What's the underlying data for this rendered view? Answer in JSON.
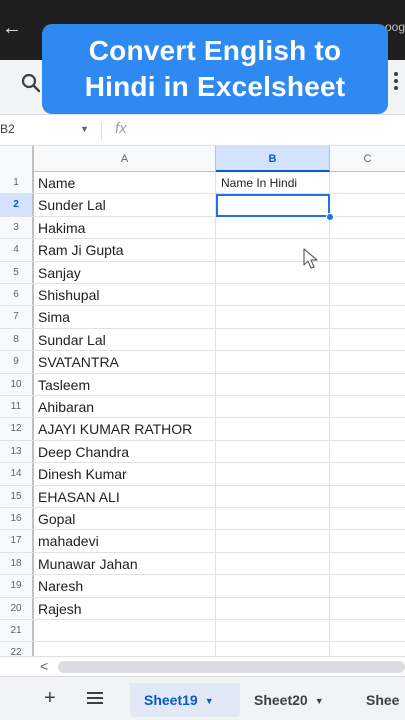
{
  "topbar": {
    "url_fragment": "oog"
  },
  "banner": {
    "line1": "Convert English to",
    "line2": "Hindi in Excelsheet"
  },
  "formula": {
    "cell_ref": "B2",
    "fx": "fx"
  },
  "columns": [
    "A",
    "B",
    "C"
  ],
  "rows": [
    {
      "num": "1",
      "a": "Name",
      "b": "Name In Hindi"
    },
    {
      "num": "2",
      "a": "Sunder Lal",
      "b": ""
    },
    {
      "num": "3",
      "a": "Hakima",
      "b": ""
    },
    {
      "num": "4",
      "a": "Ram Ji Gupta",
      "b": ""
    },
    {
      "num": "5",
      "a": "Sanjay",
      "b": ""
    },
    {
      "num": "6",
      "a": "Shishupal",
      "b": ""
    },
    {
      "num": "7",
      "a": "Sima",
      "b": ""
    },
    {
      "num": "8",
      "a": "Sundar Lal",
      "b": ""
    },
    {
      "num": "9",
      "a": "SVATANTRA",
      "b": ""
    },
    {
      "num": "10",
      "a": "Tasleem",
      "b": ""
    },
    {
      "num": "11",
      "a": "Ahibaran",
      "b": ""
    },
    {
      "num": "12",
      "a": "AJAYI KUMAR RATHOR",
      "b": ""
    },
    {
      "num": "13",
      "a": "Deep Chandra",
      "b": ""
    },
    {
      "num": "14",
      "a": "Dinesh Kumar",
      "b": ""
    },
    {
      "num": "15",
      "a": "EHASAN ALI",
      "b": ""
    },
    {
      "num": "16",
      "a": "Gopal",
      "b": ""
    },
    {
      "num": "17",
      "a": "mahadevi",
      "b": ""
    },
    {
      "num": "18",
      "a": "Munawar Jahan",
      "b": ""
    },
    {
      "num": "19",
      "a": "Naresh",
      "b": ""
    },
    {
      "num": "20",
      "a": "Rajesh",
      "b": ""
    },
    {
      "num": "21",
      "a": "",
      "b": ""
    },
    {
      "num": "22",
      "a": "",
      "b": ""
    }
  ],
  "tabs": {
    "add": "+",
    "sheet1": "Sheet19",
    "sheet2": "Sheet20",
    "sheet3": "Shee"
  },
  "colors": {
    "accent": "#2f89f2",
    "selection": "#1a73e8"
  }
}
